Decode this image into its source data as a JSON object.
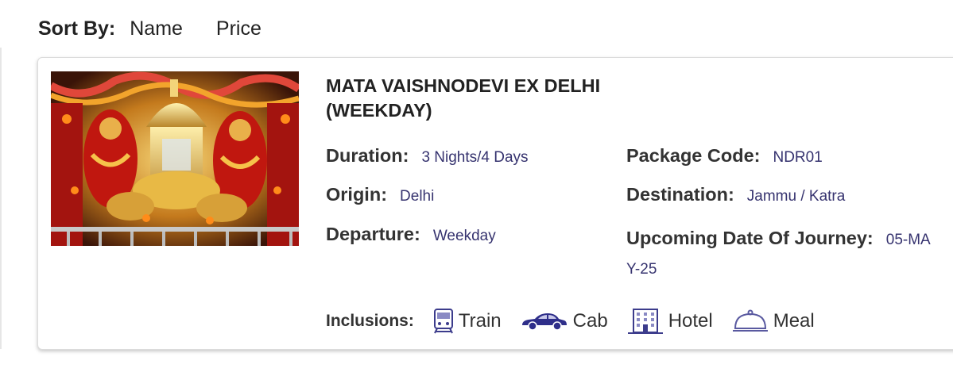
{
  "sort": {
    "label": "Sort By:",
    "options": [
      "Name",
      "Price"
    ]
  },
  "package": {
    "title": "MATA VAISHNODEVI EX DELHI (WEEKDAY)",
    "duration_label": "Duration:",
    "duration": "3 Nights/4 Days",
    "origin_label": "Origin:",
    "origin": "Delhi",
    "departure_label": "Departure:",
    "departure": "Weekday",
    "code_label": "Package Code:",
    "code": "NDR01",
    "destination_label": "Destination:",
    "destination": "Jammu / Katra",
    "upcoming_label": "Upcoming Date Of Journey:",
    "upcoming": "05-MAY-25",
    "image_alt": "Mata Vaishnodevi shrine"
  },
  "inclusions": {
    "label": "Inclusions:",
    "items": [
      {
        "label": "Train",
        "icon": "train-icon"
      },
      {
        "label": "Cab",
        "icon": "car-icon"
      },
      {
        "label": "Hotel",
        "icon": "hotel-icon"
      },
      {
        "label": "Meal",
        "icon": "meal-cloche-icon"
      }
    ]
  },
  "colors": {
    "value_text": "#36336f",
    "icon_color": "#3c3c8c",
    "label_text": "#333333"
  }
}
